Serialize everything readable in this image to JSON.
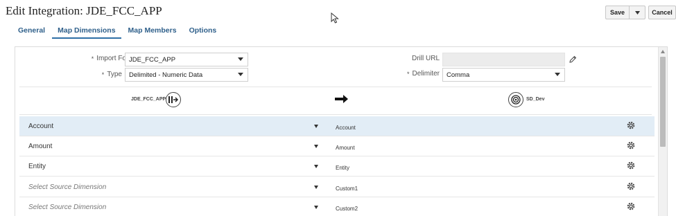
{
  "page": {
    "title": "Edit Integration: JDE_FCC_APP"
  },
  "tabs": [
    {
      "label": "General",
      "active": false
    },
    {
      "label": "Map Dimensions",
      "active": true
    },
    {
      "label": "Map Members",
      "active": false
    },
    {
      "label": "Options",
      "active": false
    }
  ],
  "toolbar": {
    "save_label": "Save",
    "cancel_label": "Cancel",
    "dropdown_icon": "chevron-down-icon"
  },
  "form": {
    "required_marker": "*",
    "import_format": {
      "label": "Import Format",
      "value": "JDE_FCC_APP"
    },
    "type": {
      "label": "Type",
      "value": "Delimited - Numeric Data"
    },
    "drill_url": {
      "label": "Drill URL",
      "value": ""
    },
    "delimiter": {
      "label": "Delimiter",
      "value": "Comma"
    }
  },
  "mapping_header": {
    "source_name": "JDE_FCC_APP",
    "source_icon": "source-connector-icon",
    "arrow_icon": "right-arrow-icon",
    "target_name": "SD_Dev",
    "target_icon": "target-icon"
  },
  "mappings": [
    {
      "source": "Account",
      "placeholder": false,
      "target": "Account",
      "selected": true
    },
    {
      "source": "Amount",
      "placeholder": false,
      "target": "Amount",
      "selected": false
    },
    {
      "source": "Entity",
      "placeholder": false,
      "target": "Entity",
      "selected": false
    },
    {
      "source": "Select Source Dimension",
      "placeholder": true,
      "target": "Custom1",
      "selected": false
    },
    {
      "source": "Select Source Dimension",
      "placeholder": true,
      "target": "Custom2",
      "selected": false
    }
  ],
  "colors": {
    "accent": "#2e6fa6",
    "selected_row": "#e2edf6",
    "tab_text": "#2e5f8a"
  }
}
